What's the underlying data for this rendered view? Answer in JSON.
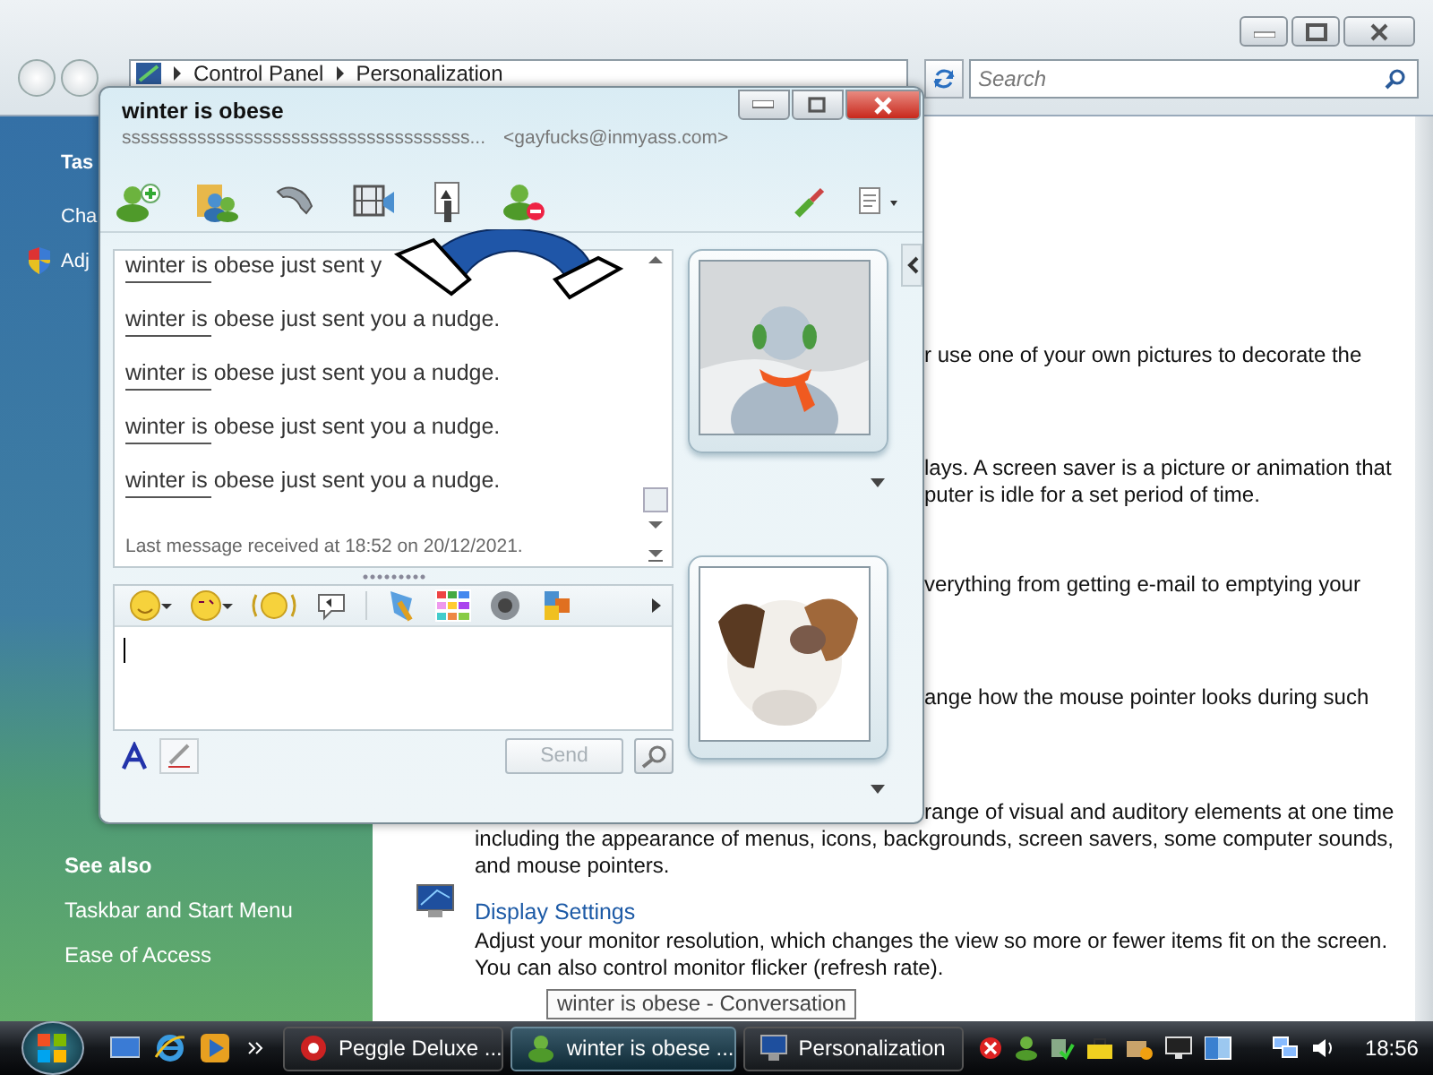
{
  "explorer": {
    "address": [
      {
        "label": "Control Panel"
      },
      {
        "label": "Personalization"
      }
    ],
    "search": {
      "placeholder": "Search"
    },
    "sidebar": {
      "tasks_heading": "Tas",
      "tasks": [
        {
          "label": "Cha",
          "kind": "link"
        },
        {
          "label": "Adj",
          "kind": "shield"
        }
      ],
      "see_also_heading": "See also",
      "see_also": [
        "Taskbar and Start Menu",
        "Ease of Access"
      ]
    },
    "content": [
      {
        "kind": "text",
        "lines": [
          {
            "text": "r use one of your own pictures to decorate the",
            "behind_window": true
          }
        ]
      },
      {
        "kind": "text",
        "lines": [
          {
            "text": "lays. A screen saver is a picture or animation that",
            "behind_window": true
          },
          {
            "text": "puter is idle for a set period of time.",
            "behind_window": true
          }
        ]
      },
      {
        "kind": "text",
        "lines": [
          {
            "text": "verything from getting e-mail to emptying your",
            "behind_window": true
          }
        ]
      },
      {
        "kind": "text",
        "lines": [
          {
            "text": "ange how the mouse pointer looks during such",
            "behind_window": true
          }
        ]
      },
      {
        "kind": "text",
        "lines": [
          {
            "text": "range of visual and auditory elements at one time",
            "behind_window": true
          },
          {
            "text": "including the appearance of menus, icons, backgrounds, screen savers, some computer sounds,",
            "behind_window": false
          },
          {
            "text": "and mouse pointers.",
            "behind_window": false
          }
        ]
      },
      {
        "kind": "item",
        "link": "Display Settings",
        "lines": [
          {
            "text": "Adjust your monitor resolution, which changes the view so more or fewer items fit on the screen.",
            "behind_window": false
          },
          {
            "text": "You can also control monitor flicker (refresh rate).",
            "behind_window": false
          }
        ]
      }
    ]
  },
  "chat": {
    "title": "winter is obese",
    "status_line": "sssssssssssssssssssssssssssssssssssss...",
    "email": "<gayfucks@inmyass.com>",
    "messages": [
      "winter is obese just sent y",
      "winter is obese just sent you a nudge.",
      "winter is obese just sent you a nudge.",
      "winter is obese just sent you a nudge.",
      "winter is obese just sent you a nudge."
    ],
    "last_message": "Last message received at 18:52 on 20/12/2021.",
    "send_button": {
      "label": "Send",
      "disabled": true
    }
  },
  "tooltip": "winter is obese - Conversation",
  "taskbar": {
    "buttons": [
      {
        "label": "Peggle Deluxe ...",
        "kind": "peggle",
        "selected": false
      },
      {
        "label": "winter is obese ...",
        "kind": "messenger",
        "selected": true
      },
      {
        "label": "Personalization",
        "kind": "display",
        "selected": false
      }
    ],
    "clock": "18:56"
  }
}
